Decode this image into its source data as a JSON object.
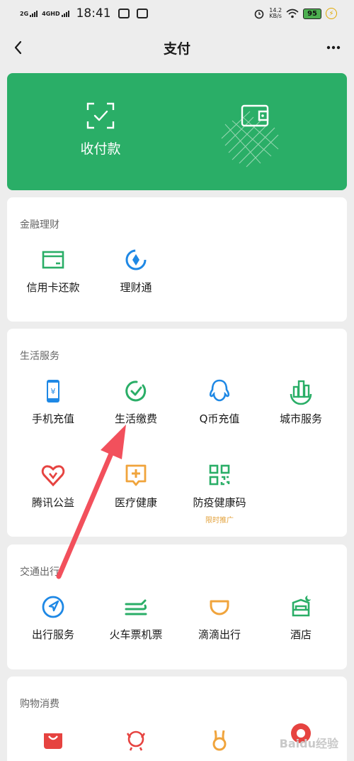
{
  "status_bar": {
    "net1": "2G",
    "net2": "4GHD",
    "time": "18:41",
    "speed_value": "14.2",
    "speed_unit": "KB/s",
    "battery": "95"
  },
  "nav": {
    "title": "支付"
  },
  "banner": {
    "left_label": "收付款"
  },
  "sections": {
    "finance": {
      "title": "金融理财",
      "items": [
        {
          "label": "信用卡还款",
          "icon": "credit-card-icon"
        },
        {
          "label": "理财通",
          "icon": "licaitong-icon"
        }
      ]
    },
    "life": {
      "title": "生活服务",
      "items": [
        {
          "label": "手机充值",
          "icon": "phone-recharge-icon"
        },
        {
          "label": "生活缴费",
          "icon": "utility-payment-icon"
        },
        {
          "label": "Q币充值",
          "icon": "qq-coin-icon"
        },
        {
          "label": "城市服务",
          "icon": "city-service-icon"
        },
        {
          "label": "腾讯公益",
          "icon": "charity-icon"
        },
        {
          "label": "医疗健康",
          "icon": "medical-icon"
        },
        {
          "label": "防疫健康码",
          "icon": "qr-code-icon",
          "sub": "限时推广"
        }
      ]
    },
    "travel": {
      "title": "交通出行",
      "items": [
        {
          "label": "出行服务",
          "icon": "navigation-icon"
        },
        {
          "label": "火车票机票",
          "icon": "train-ticket-icon"
        },
        {
          "label": "滴滴出行",
          "icon": "didi-icon"
        },
        {
          "label": "酒店",
          "icon": "hotel-icon"
        }
      ]
    },
    "shopping": {
      "title": "购物消费"
    }
  },
  "watermark": "Baidu经验",
  "colors": {
    "green": "#2aae67",
    "blue": "#1e88e5",
    "orange": "#f0a43c",
    "red": "#e64340"
  }
}
